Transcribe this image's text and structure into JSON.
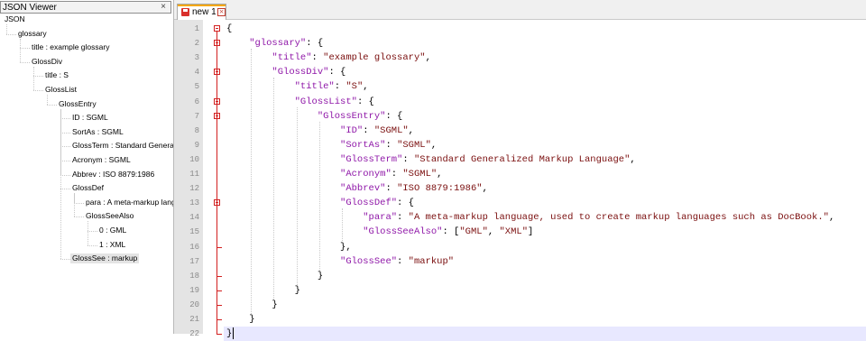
{
  "json_viewer": {
    "title": "JSON Viewer",
    "close_glyph": "×",
    "tree": [
      {
        "label": "JSON"
      },
      {
        "label": "glossary"
      },
      {
        "label": "title : example glossary"
      },
      {
        "label": "GlossDiv"
      },
      {
        "label": "title : S"
      },
      {
        "label": "GlossList"
      },
      {
        "label": "GlossEntry"
      },
      {
        "label": "ID : SGML"
      },
      {
        "label": "SortAs : SGML"
      },
      {
        "label": "GlossTerm : Standard Generalized Markup Language"
      },
      {
        "label": "Acronym : SGML"
      },
      {
        "label": "Abbrev : ISO 8879:1986"
      },
      {
        "label": "GlossDef"
      },
      {
        "label": "para : A meta-markup language, used to create markup languages such as DocBook."
      },
      {
        "label": "GlossSeeAlso"
      },
      {
        "label": "0 : GML"
      },
      {
        "label": "1 : XML"
      },
      {
        "label": "GlossSee : markup",
        "selected": true
      }
    ]
  },
  "editor": {
    "tab_label": "new 1",
    "tab_close_glyph": "×",
    "save_icon": "floppy-disk-icon",
    "colors": {
      "key": "#8f17a8",
      "string": "#7a0e0e",
      "fold": "#d21f1f",
      "tab_accent": "#f5a700",
      "current_line": "#e8e8ff"
    },
    "lines": [
      {
        "n": "1",
        "tokens": [
          {
            "t": "p",
            "v": "{"
          }
        ]
      },
      {
        "n": "2",
        "tokens": [
          {
            "t": "p",
            "v": "    "
          },
          {
            "t": "k",
            "v": "\"glossary\""
          },
          {
            "t": "p",
            "v": ": {"
          }
        ]
      },
      {
        "n": "3",
        "tokens": [
          {
            "t": "p",
            "v": "        "
          },
          {
            "t": "k",
            "v": "\"title\""
          },
          {
            "t": "p",
            "v": ": "
          },
          {
            "t": "s",
            "v": "\"example glossary\""
          },
          {
            "t": "p",
            "v": ","
          }
        ]
      },
      {
        "n": "4",
        "tokens": [
          {
            "t": "p",
            "v": "        "
          },
          {
            "t": "k",
            "v": "\"GlossDiv\""
          },
          {
            "t": "p",
            "v": ": {"
          }
        ]
      },
      {
        "n": "5",
        "tokens": [
          {
            "t": "p",
            "v": "            "
          },
          {
            "t": "k",
            "v": "\"title\""
          },
          {
            "t": "p",
            "v": ": "
          },
          {
            "t": "s",
            "v": "\"S\""
          },
          {
            "t": "p",
            "v": ","
          }
        ]
      },
      {
        "n": "6",
        "tokens": [
          {
            "t": "p",
            "v": "            "
          },
          {
            "t": "k",
            "v": "\"GlossList\""
          },
          {
            "t": "p",
            "v": ": {"
          }
        ]
      },
      {
        "n": "7",
        "tokens": [
          {
            "t": "p",
            "v": "                "
          },
          {
            "t": "k",
            "v": "\"GlossEntry\""
          },
          {
            "t": "p",
            "v": ": {"
          }
        ]
      },
      {
        "n": "8",
        "tokens": [
          {
            "t": "p",
            "v": "                    "
          },
          {
            "t": "k",
            "v": "\"ID\""
          },
          {
            "t": "p",
            "v": ": "
          },
          {
            "t": "s",
            "v": "\"SGML\""
          },
          {
            "t": "p",
            "v": ","
          }
        ]
      },
      {
        "n": "9",
        "tokens": [
          {
            "t": "p",
            "v": "                    "
          },
          {
            "t": "k",
            "v": "\"SortAs\""
          },
          {
            "t": "p",
            "v": ": "
          },
          {
            "t": "s",
            "v": "\"SGML\""
          },
          {
            "t": "p",
            "v": ","
          }
        ]
      },
      {
        "n": "10",
        "tokens": [
          {
            "t": "p",
            "v": "                    "
          },
          {
            "t": "k",
            "v": "\"GlossTerm\""
          },
          {
            "t": "p",
            "v": ": "
          },
          {
            "t": "s",
            "v": "\"Standard Generalized Markup Language\""
          },
          {
            "t": "p",
            "v": ","
          }
        ]
      },
      {
        "n": "11",
        "tokens": [
          {
            "t": "p",
            "v": "                    "
          },
          {
            "t": "k",
            "v": "\"Acronym\""
          },
          {
            "t": "p",
            "v": ": "
          },
          {
            "t": "s",
            "v": "\"SGML\""
          },
          {
            "t": "p",
            "v": ","
          }
        ]
      },
      {
        "n": "12",
        "tokens": [
          {
            "t": "p",
            "v": "                    "
          },
          {
            "t": "k",
            "v": "\"Abbrev\""
          },
          {
            "t": "p",
            "v": ": "
          },
          {
            "t": "s",
            "v": "\"ISO 8879:1986\""
          },
          {
            "t": "p",
            "v": ","
          }
        ]
      },
      {
        "n": "13",
        "tokens": [
          {
            "t": "p",
            "v": "                    "
          },
          {
            "t": "k",
            "v": "\"GlossDef\""
          },
          {
            "t": "p",
            "v": ": {"
          }
        ]
      },
      {
        "n": "14",
        "tokens": [
          {
            "t": "p",
            "v": "                        "
          },
          {
            "t": "k",
            "v": "\"para\""
          },
          {
            "t": "p",
            "v": ": "
          },
          {
            "t": "s",
            "v": "\"A meta-markup language, used to create markup languages such as DocBook.\""
          },
          {
            "t": "p",
            "v": ","
          }
        ]
      },
      {
        "n": "15",
        "tokens": [
          {
            "t": "p",
            "v": "                        "
          },
          {
            "t": "k",
            "v": "\"GlossSeeAlso\""
          },
          {
            "t": "p",
            "v": ": ["
          },
          {
            "t": "s",
            "v": "\"GML\""
          },
          {
            "t": "p",
            "v": ", "
          },
          {
            "t": "s",
            "v": "\"XML\""
          },
          {
            "t": "p",
            "v": "]"
          }
        ]
      },
      {
        "n": "16",
        "tokens": [
          {
            "t": "p",
            "v": "                    },"
          }
        ]
      },
      {
        "n": "17",
        "tokens": [
          {
            "t": "p",
            "v": "                    "
          },
          {
            "t": "k",
            "v": "\"GlossSee\""
          },
          {
            "t": "p",
            "v": ": "
          },
          {
            "t": "s",
            "v": "\"markup\""
          }
        ]
      },
      {
        "n": "18",
        "tokens": [
          {
            "t": "p",
            "v": "                }"
          }
        ]
      },
      {
        "n": "19",
        "tokens": [
          {
            "t": "p",
            "v": "            }"
          }
        ]
      },
      {
        "n": "20",
        "tokens": [
          {
            "t": "p",
            "v": "        }"
          }
        ]
      },
      {
        "n": "21",
        "tokens": [
          {
            "t": "p",
            "v": "    }"
          }
        ]
      },
      {
        "n": "22",
        "tokens": [
          {
            "t": "p",
            "v": "}"
          }
        ],
        "current": true
      }
    ]
  }
}
